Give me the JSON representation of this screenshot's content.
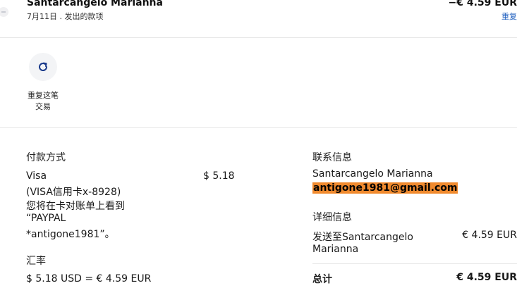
{
  "header": {
    "name": "Santarcangelo Marianna",
    "subtitle": "7月11日 . 发出的款项",
    "amount": "−€ 4.59 EUR",
    "link": "重复"
  },
  "actions": {
    "repeat_label_line1": "重复这笔",
    "repeat_label_line2": "交易"
  },
  "payment": {
    "title": "付款方式",
    "method": "Visa",
    "card": "(VISA信用卡x-8928)",
    "note_line1": "您将在卡对账单上看到",
    "note_line2": "“PAYPAL",
    "note_line3": "*antigone1981”。",
    "amount": "$ 5.18"
  },
  "exchange": {
    "title": "汇率",
    "rate": "$ 5.18 USD = € 4.59 EUR"
  },
  "contact": {
    "title": "联系信息",
    "name": "Santarcangelo Marianna",
    "email": "antigone1981@gmail.com"
  },
  "details": {
    "title": "详细信息",
    "sent_to_line1": "发送至Santarcangelo",
    "sent_to_line2": "Marianna",
    "sent_amount": "€ 4.59 EUR",
    "total_label": "总计",
    "total_amount": "€ 4.59 EUR"
  },
  "colors": {
    "link": "#1f5fbf",
    "highlight": "#f08a2e"
  }
}
